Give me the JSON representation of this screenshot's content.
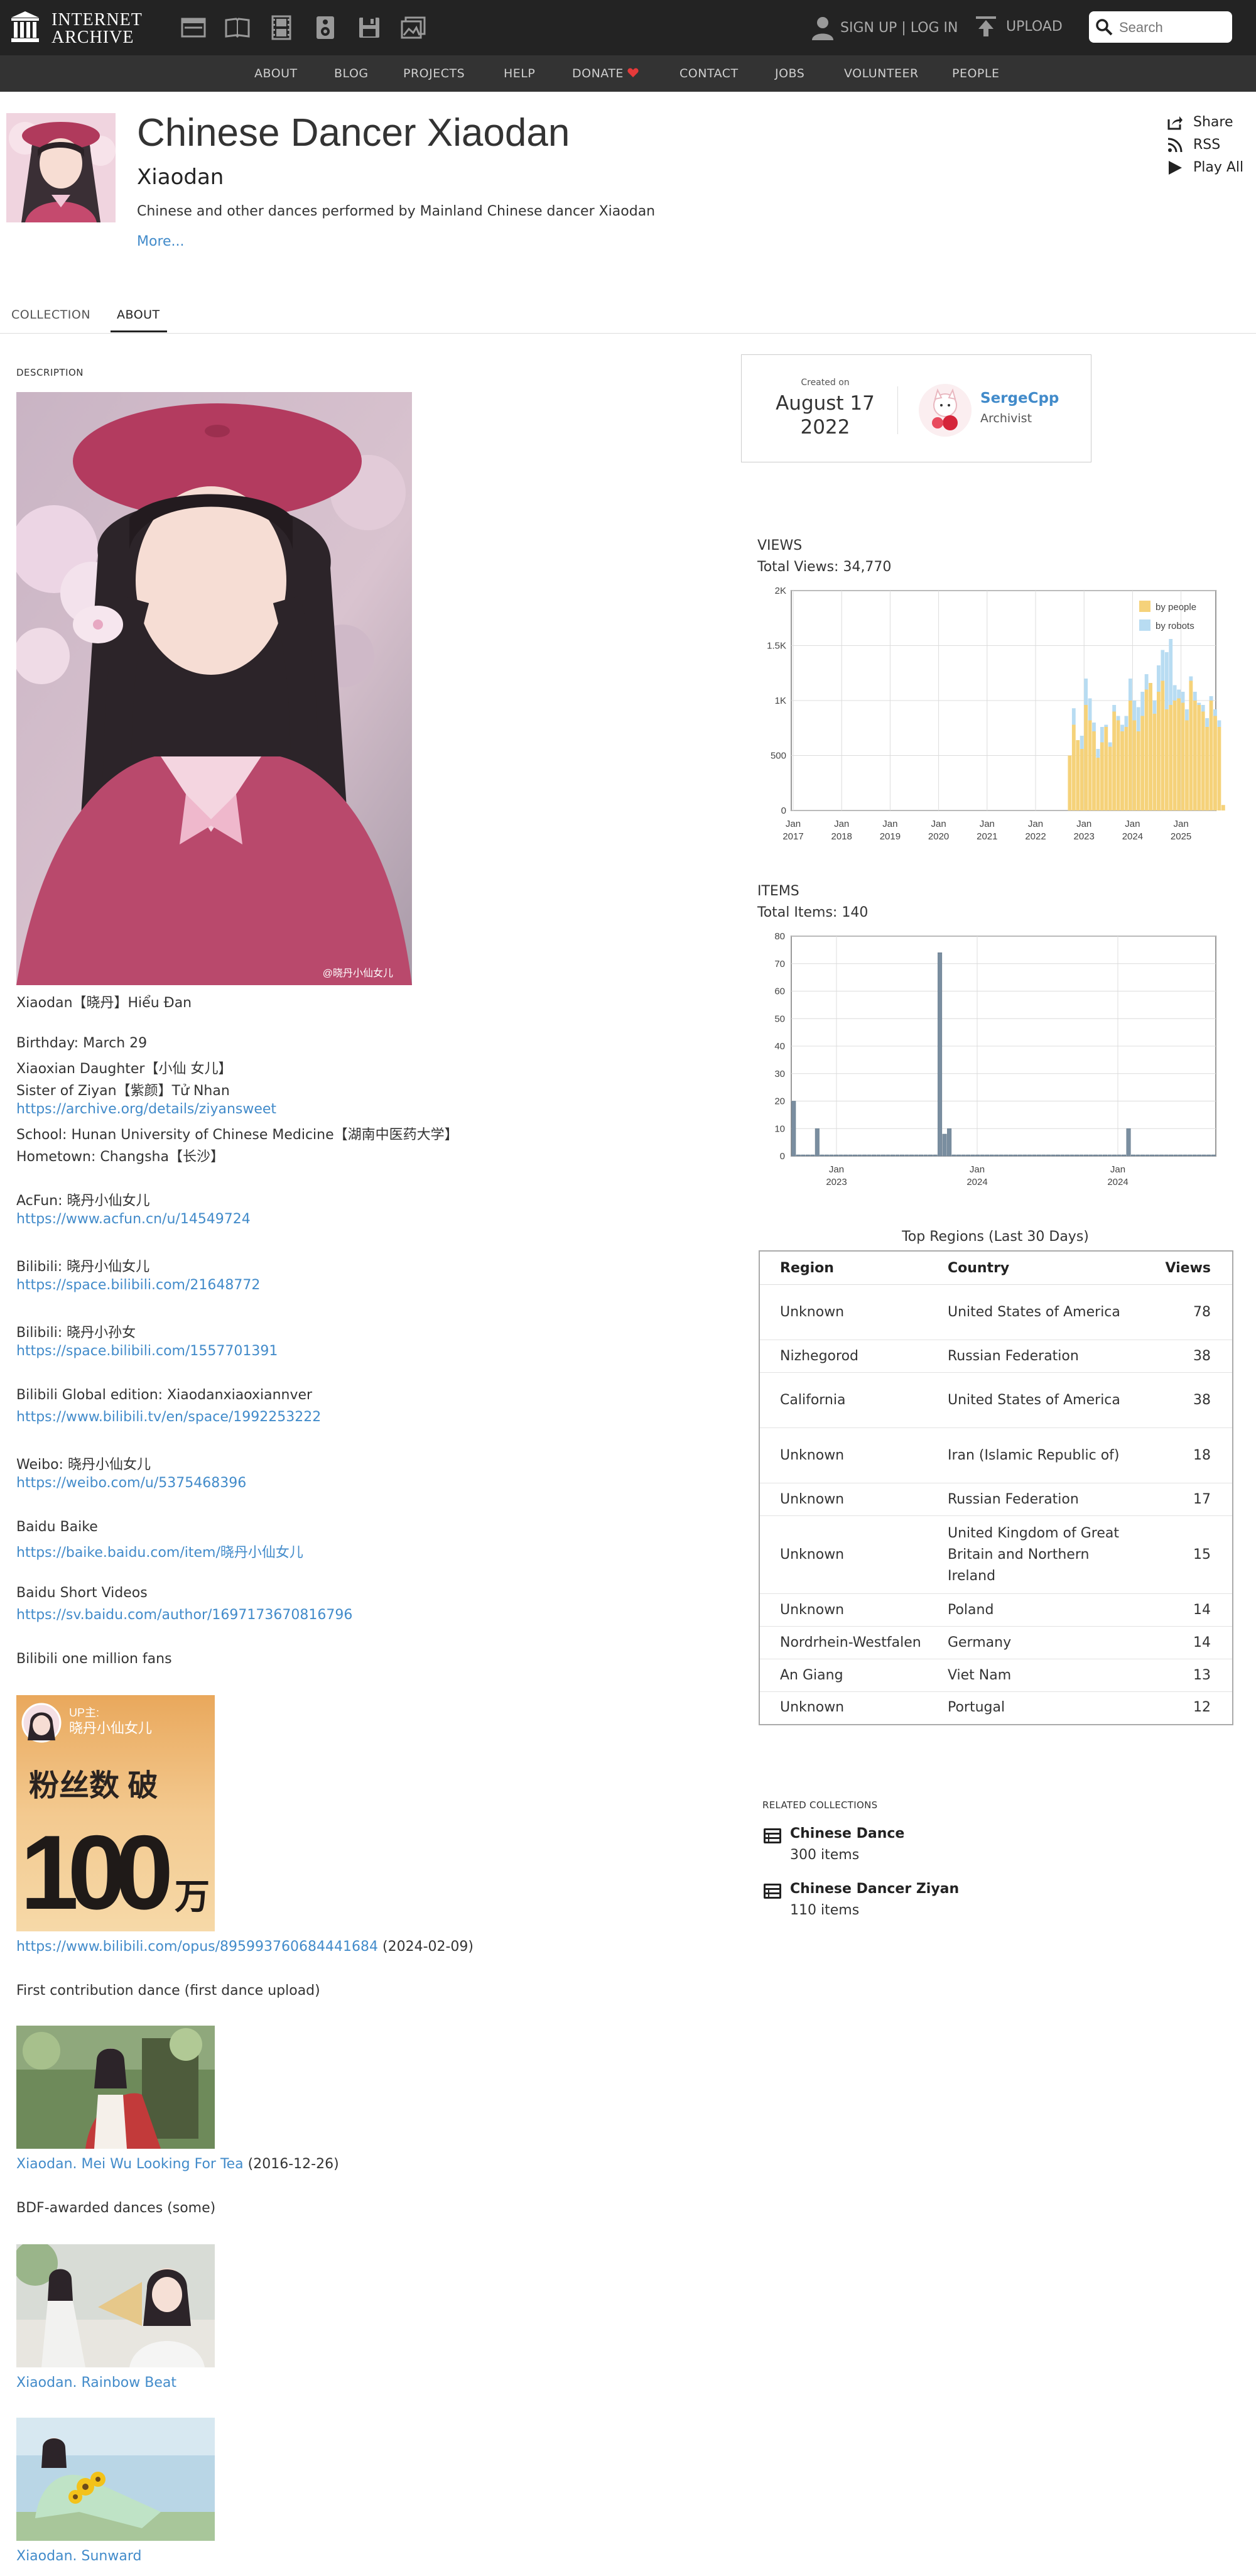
{
  "site": {
    "logo_line1": "INTERNET",
    "logo_line2": "ARCHIVE"
  },
  "topbar": {
    "media_icons": [
      "web-icon",
      "texts-icon",
      "video-icon",
      "audio-icon",
      "software-icon",
      "images-icon"
    ],
    "signup_label": "SIGN UP | LOG IN",
    "upload_label": "UPLOAD",
    "search_placeholder": "Search"
  },
  "nav": [
    "ABOUT",
    "BLOG",
    "PROJECTS",
    "HELP",
    "DONATE",
    "CONTACT",
    "JOBS",
    "VOLUNTEER",
    "PEOPLE"
  ],
  "header": {
    "title": "Chinese Dancer Xiaodan",
    "subtitle": "Xiaodan",
    "tagline": "Chinese and other dances performed by Mainland Chinese dancer Xiaodan",
    "more": "More...",
    "actions": [
      "Share",
      "RSS",
      "Play All"
    ]
  },
  "tabs": [
    "COLLECTION",
    "ABOUT"
  ],
  "description": {
    "heading": "DESCRIPTION",
    "photo_watermark": "@晓丹小仙女儿",
    "name_line": "Xiaodan【晓丹】Hiểu Đan",
    "birthday": "Birthday: March 29",
    "daughter": "Xiaoxian Daughter【小仙 女儿】",
    "sister": "Sister of Ziyan【紫颜】Tử Nhan",
    "sister_link": "https://archive.org/details/ziyansweet",
    "school": "School: Hunan University of Chinese Medicine【湖南中医药大学】",
    "hometown": "Hometown: Changsha【长沙】",
    "acfun": "AcFun: 晓丹小仙女儿",
    "acfun_link": "https://www.acfun.cn/u/14549724",
    "bili1": "Bilibili: 晓丹小仙女儿",
    "bili1_link": "https://space.bilibili.com/21648772",
    "bili2": "Bilibili: 晓丹小孙女",
    "bili2_link": "https://space.bilibili.com/1557701391",
    "bili_global": "Bilibili Global edition: Xiaodanxiaoxiannver",
    "bili_global_link": "https://www.bilibili.tv/en/space/1992253222",
    "weibo": "Weibo: 晓丹小仙女儿",
    "weibo_link": "https://weibo.com/u/5375468396",
    "baike": "Baidu Baike",
    "baike_link": "https://baike.baidu.com/item/晓丹小仙女儿",
    "short_videos": "Baidu Short Videos",
    "short_videos_link": "https://sv.baidu.com/author/1697173670816796",
    "million": "Bilibili one million fans",
    "poster": {
      "up_label": "UP主:",
      "up_name": "晓丹小仙女儿",
      "text1": "粉丝数 破",
      "big": "100",
      "wan": "万"
    },
    "opus_link": "https://www.bilibili.com/opus/895993760684441684",
    "opus_date": " (2024-02-09)",
    "first": "First contribution dance (first dance upload)",
    "meiwu_link": "Xiaodan. Mei Wu Looking For Tea",
    "meiwu_date": " (2016-12-26)",
    "bdf": "BDF-awarded dances (some)",
    "rainbow_link": "Xiaodan. Rainbow Beat",
    "sunward_link": "Xiaodan. Sunward"
  },
  "created": {
    "caption": "Created on",
    "date_line1": "August 17",
    "date_line2": "2022",
    "user": "SergeCpp",
    "role": "Archivist"
  },
  "views": {
    "heading": "VIEWS",
    "total": "Total Views: 34,770",
    "legend": [
      "by people",
      "by robots"
    ],
    "colors": {
      "people": "#f5d27a",
      "robots": "#b8dcf2"
    }
  },
  "items": {
    "heading": "ITEMS",
    "total": "Total Items: 140",
    "color": "#7a8ea0"
  },
  "chart_data": [
    {
      "type": "bar",
      "title": "VIEWS",
      "ylim": [
        0,
        2000
      ],
      "yticks": [
        "0",
        "500",
        "1K",
        "1.5K",
        "2K"
      ],
      "xticks": [
        "Jan 2017",
        "Jan 2018",
        "Jan 2019",
        "Jan 2020",
        "Jan 2021",
        "Jan 2022",
        "Jan 2023",
        "Jan 2024",
        "Jan 2025"
      ],
      "x_start": "2022-09",
      "x_step": "month",
      "grid": true,
      "legend_position": "top-right",
      "series": [
        {
          "name": "by people",
          "values": [
            500,
            780,
            640,
            560,
            960,
            820,
            720,
            480,
            620,
            760,
            580,
            900,
            820,
            720,
            760,
            1000,
            820,
            720,
            860,
            1100,
            1160,
            880,
            1080,
            1180,
            920,
            960,
            1000,
            1020,
            980,
            820,
            1180,
            1000,
            960,
            900,
            760,
            1000,
            860,
            760,
            50
          ]
        },
        {
          "name": "by robots",
          "values": [
            0,
            150,
            0,
            120,
            240,
            200,
            80,
            80,
            140,
            20,
            40,
            60,
            40,
            60,
            100,
            200,
            180,
            220,
            220,
            140,
            0,
            120,
            240,
            280,
            520,
            600,
            140,
            80,
            100,
            100,
            40,
            80,
            20,
            60,
            80,
            40,
            60,
            60,
            0
          ]
        }
      ]
    },
    {
      "type": "bar",
      "title": "ITEMS",
      "ylim": [
        0,
        80
      ],
      "yticks": [
        "0",
        "10",
        "20",
        "30",
        "40",
        "50",
        "60",
        "70",
        "80"
      ],
      "xticks": [
        "Jan 2023",
        "Jan 2024",
        "Jan 2024"
      ],
      "grid": true,
      "series": [
        {
          "name": "",
          "values": [
            20,
            0,
            0,
            0,
            0,
            10,
            0,
            0,
            0,
            0,
            0,
            0,
            0,
            0,
            0,
            0,
            0,
            0,
            0,
            0,
            0,
            0,
            0,
            0,
            0,
            0,
            0,
            0,
            0,
            0,
            0,
            74,
            8,
            10,
            0,
            0,
            0,
            0,
            0,
            0,
            0,
            0,
            0,
            0,
            0,
            0,
            0,
            0,
            0,
            0,
            0,
            0,
            0,
            0,
            0,
            0,
            0,
            0,
            0,
            0,
            0,
            0,
            0,
            0,
            0,
            0,
            0,
            0,
            0,
            0,
            0,
            10,
            0,
            0,
            0,
            0,
            0,
            0,
            0,
            0,
            0,
            0,
            0,
            0,
            0,
            0,
            0,
            0,
            0,
            0
          ]
        }
      ]
    }
  ],
  "regions": {
    "caption": "Top Regions (Last 30 Days)",
    "headers": [
      "Region",
      "Country",
      "Views"
    ],
    "rows": [
      [
        "Unknown",
        "United States of America",
        "78"
      ],
      [
        "Nizhegorod",
        "Russian Federation",
        "38"
      ],
      [
        "California",
        "United States of America",
        "38"
      ],
      [
        "Unknown",
        "Iran (Islamic Republic of)",
        "18"
      ],
      [
        "Unknown",
        "Russian Federation",
        "17"
      ],
      [
        "Unknown",
        "United Kingdom of Great Britain and Northern Ireland",
        "15"
      ],
      [
        "Unknown",
        "Poland",
        "14"
      ],
      [
        "Nordrhein-Westfalen",
        "Germany",
        "14"
      ],
      [
        "An Giang",
        "Viet Nam",
        "13"
      ],
      [
        "Unknown",
        "Portugal",
        "12"
      ]
    ]
  },
  "related": {
    "heading": "RELATED COLLECTIONS",
    "items": [
      {
        "name": "Chinese Dance",
        "count": "300 items"
      },
      {
        "name": "Chinese Dancer Ziyan",
        "count": "110 items"
      }
    ]
  }
}
